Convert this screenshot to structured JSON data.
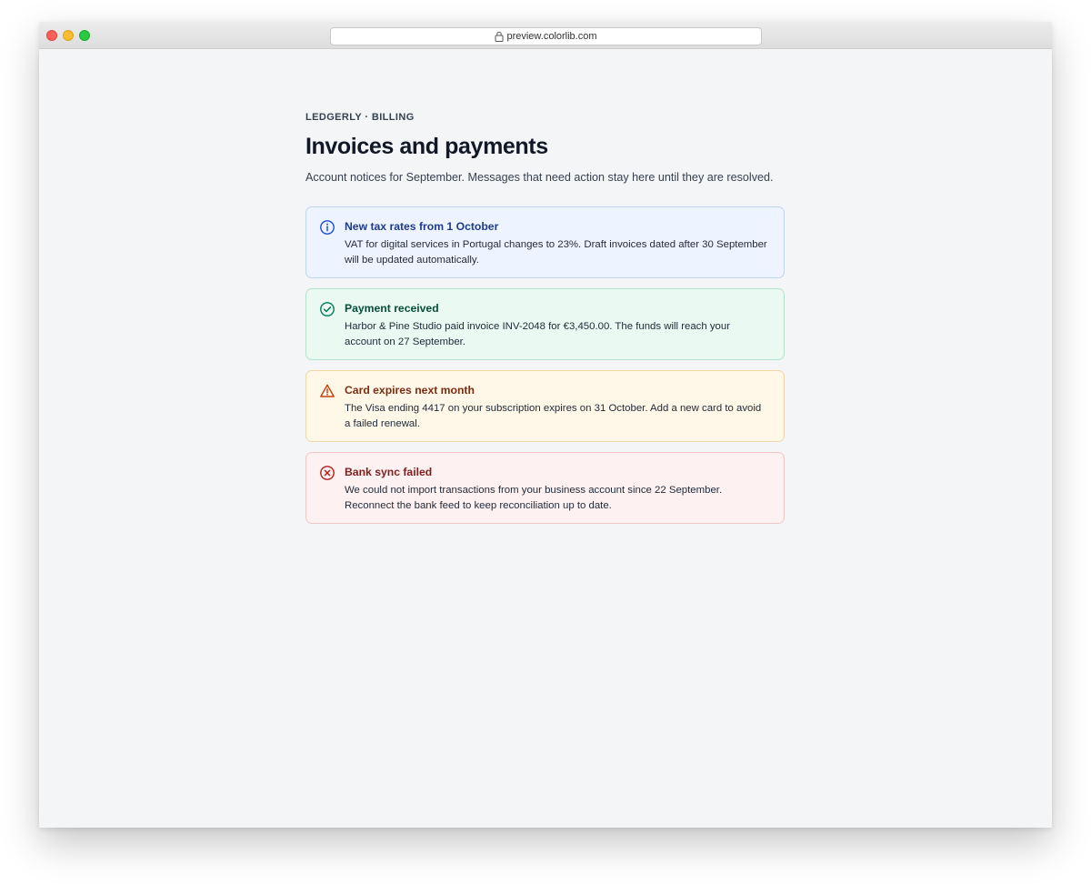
{
  "browser": {
    "url": "preview.colorlib.com"
  },
  "page": {
    "eyebrow": "LEDGERLY · BILLING",
    "title": "Invoices and payments",
    "subtitle": "Account notices for September. Messages that need action stay here until they are resolved."
  },
  "alerts": [
    {
      "variant": "info",
      "icon": "info-circle-icon",
      "color": "#1d4ed8",
      "title": "New tax rates from 1 October",
      "body": "VAT for digital services in Portugal changes to 23%. Draft invoices dated after 30 September will be updated automatically."
    },
    {
      "variant": "success",
      "icon": "check-circle-icon",
      "color": "#047857",
      "title": "Payment received",
      "body": "Harbor & Pine Studio paid invoice INV-2048 for €3,450.00. The funds will reach your account on 27 September."
    },
    {
      "variant": "warning",
      "icon": "warning-triangle-icon",
      "color": "#c2410c",
      "title": "Card expires next month",
      "body": "The Visa ending 4417 on your subscription expires on 31 October. Add a new card to avoid a failed renewal."
    },
    {
      "variant": "error",
      "icon": "x-circle-icon",
      "color": "#b91c1c",
      "title": "Bank sync failed",
      "body": "We could not import transactions from your business account since 22 September. Reconnect the bank feed to keep reconciliation up to date."
    }
  ]
}
